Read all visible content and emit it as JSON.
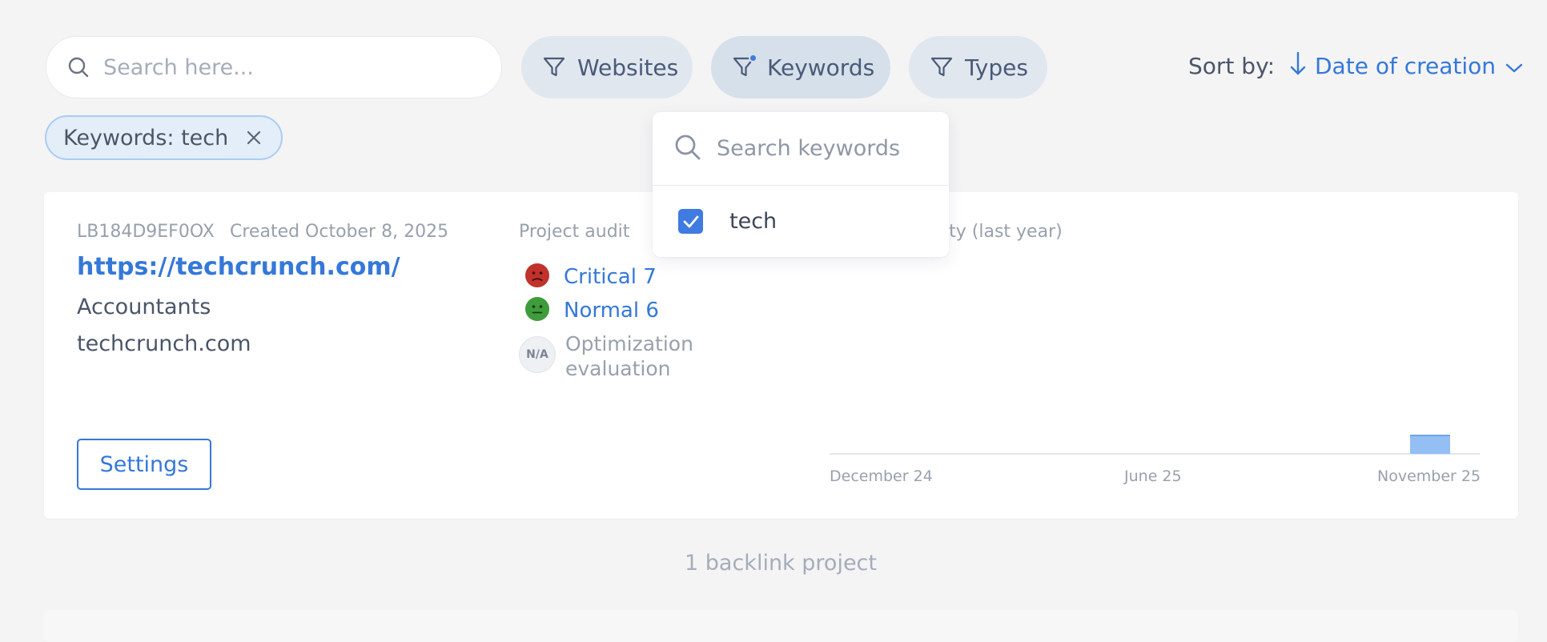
{
  "search": {
    "placeholder": "Search here..."
  },
  "filters": {
    "websites": "Websites",
    "keywords": "Keywords",
    "types": "Types"
  },
  "sort": {
    "label": "Sort by:",
    "value": "Date of creation"
  },
  "active_filter": {
    "label": "Keywords: tech"
  },
  "keyword_dropdown": {
    "placeholder": "Search keywords",
    "options": [
      {
        "label": "tech",
        "checked": true
      }
    ]
  },
  "project": {
    "id": "LB184D9EF0OX",
    "created": "Created October 8, 2025",
    "url": "https://techcrunch.com/",
    "category": "Accountants",
    "domain": "techcrunch.com",
    "audit_title": "Project audit",
    "audit": {
      "critical": "Critical 7",
      "normal": "Normal 6",
      "na_badge": "N/A",
      "optimization": "Optimization evaluation"
    },
    "activity_title": "vity (last year)",
    "settings_label": "Settings"
  },
  "chart_data": {
    "type": "bar",
    "x_tick_labels": [
      "December 24",
      "June 25",
      "November 25"
    ],
    "bars": [
      {
        "period": "November 25",
        "value": 1
      }
    ],
    "ylim": [
      0,
      2
    ]
  },
  "footer": {
    "count": "1 backlink project"
  },
  "colors": {
    "accent": "#3578d8",
    "critical": "#c0322b",
    "normal": "#3f9c3a",
    "bar": "#93bff5"
  }
}
